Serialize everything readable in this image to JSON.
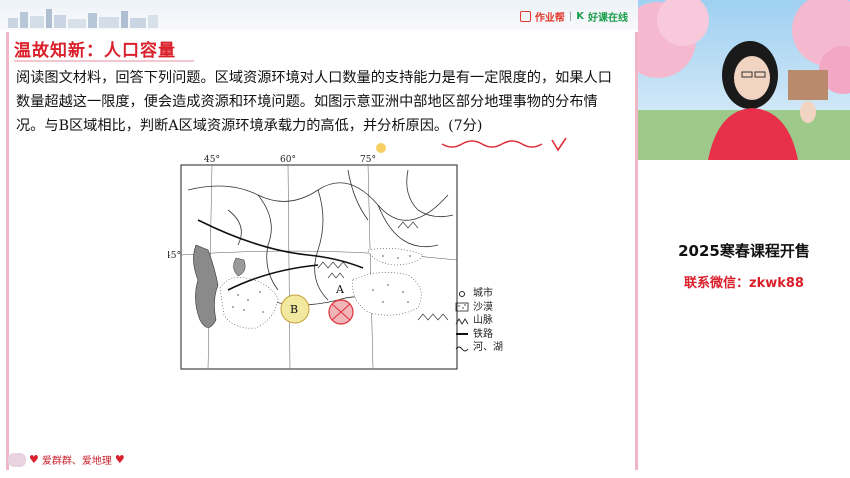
{
  "header": {
    "brand_zy": "作业帮",
    "brand_sep": "|",
    "brand_hk": "好课在线"
  },
  "slide": {
    "title": "温故知新：人口容量",
    "paragraph": "阅读图文材料，回答下列问题。区域资源环境对人口数量的支持能力是有一定限度的，如果人口数量超越这一限度，便会造成资源和环境问题。如图示意亚洲中部地区部分地理事物的分布情况。与B区域相比，判断A区域资源环境承载力的高低，并分析原因。(7分)",
    "footer_text": "爱群群、爱地理"
  },
  "map": {
    "lon_labels": [
      "45°",
      "60°",
      "75°"
    ],
    "lat_label": "45°",
    "region_a": "A",
    "region_b": "B",
    "legend": [
      {
        "icon": "city-icon",
        "label": "城市"
      },
      {
        "icon": "desert-icon",
        "label": "沙漠"
      },
      {
        "icon": "mountain-icon",
        "label": "山脉"
      },
      {
        "icon": "railway-icon",
        "label": "铁路"
      },
      {
        "icon": "river-lake-icon",
        "label": "河、湖"
      }
    ]
  },
  "promo": {
    "title": "2025寒春课程开售",
    "wechat": "联系微信：zkwk88"
  },
  "colors": {
    "title_red": "#d9202b",
    "card_border": "#f0b6c5",
    "annotation_red": "#e0303b"
  }
}
